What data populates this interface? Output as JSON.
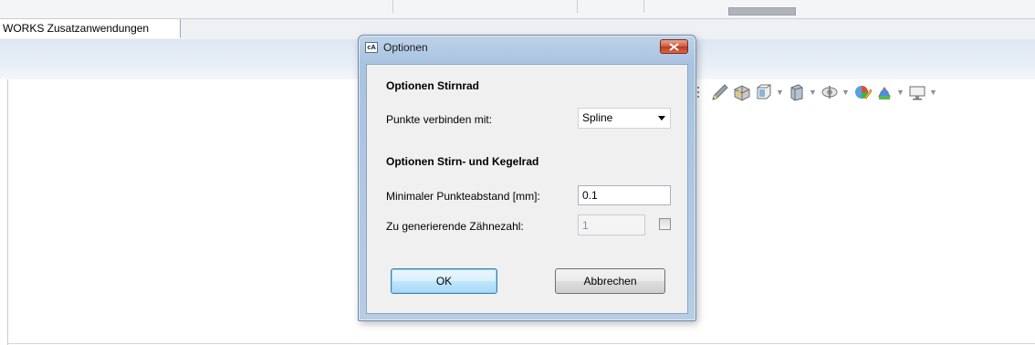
{
  "app": {
    "tab_label": "WORKS Zusatzanwendungen"
  },
  "view_toolbar": {
    "icons": [
      "pencil-sketch-icon",
      "section-view-icon",
      "view-orientation-icon",
      "display-style-icon",
      "hide-show-icon",
      "edit-appearance-icon",
      "apply-scene-icon",
      "view-settings-icon"
    ]
  },
  "dialog": {
    "title": "Optionen",
    "title_icon_text": "cA",
    "section1_heading": "Optionen Stirnrad",
    "punkte_label": "Punkte verbinden mit:",
    "punkte_value": "Spline",
    "section2_heading": "Optionen Stirn- und Kegelrad",
    "abstand_label": "Minimaler Punkteabstand [mm]:",
    "abstand_value": "0.1",
    "zahne_label": "Zu generierende Zähnezahl:",
    "zahne_value": "1",
    "zahne_checked": false,
    "ok_label": "OK",
    "cancel_label": "Abbrechen"
  },
  "colors": {
    "title_bar": "#bfd3ea",
    "close_button": "#c0391d",
    "default_button_border": "#3c7fb1"
  }
}
